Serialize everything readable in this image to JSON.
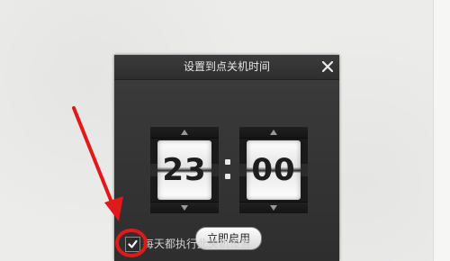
{
  "dialog": {
    "title": "设置到点关机时间",
    "close_symbol": "✕",
    "hours": "23",
    "separator": ":",
    "minutes": "00",
    "start_button": "立即启用",
    "daily_checkbox_label": "每天都执行此关机设置",
    "daily_checked": true
  },
  "annotation": {
    "arrow_color": "#e0191b",
    "circle_color": "#e0191b"
  }
}
